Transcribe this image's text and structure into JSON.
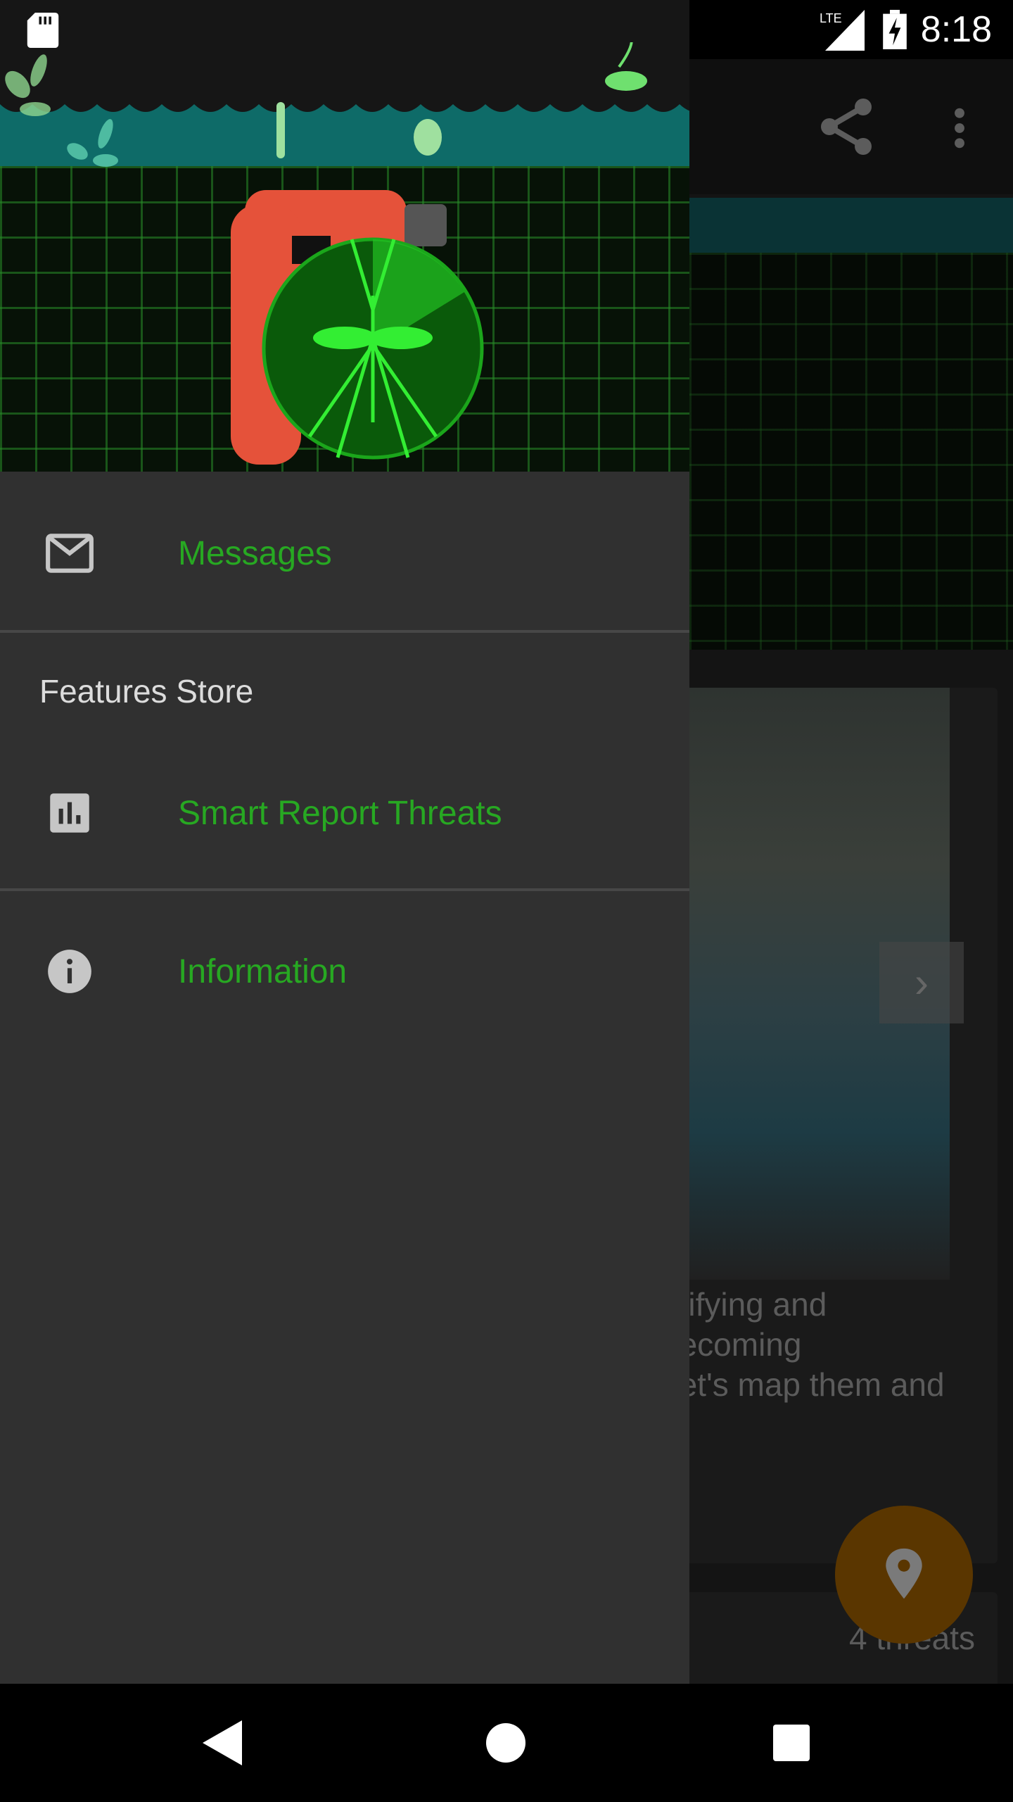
{
  "status_bar": {
    "time": "8:18",
    "network": "LTE",
    "icons": [
      "sd-card-icon",
      "signal-icon",
      "battery-charging-icon"
    ]
  },
  "background": {
    "card_text": [
      "ntifying and",
      "becoming",
      "Let's map them and"
    ],
    "threats_count": "4 threats",
    "fab_icon": "location-pin-icon",
    "toolbar_icons": [
      "share-icon",
      "more-vert-icon"
    ]
  },
  "drawer": {
    "items": [
      {
        "label": "Messages",
        "icon": "mail-icon"
      },
      {
        "label": "Smart Report Threats",
        "icon": "bar-chart-icon"
      },
      {
        "label": "Information",
        "icon": "info-icon"
      }
    ],
    "section_title": "Features Store"
  },
  "colors": {
    "accent": "#27a822",
    "drawer_bg": "#303030",
    "teal": "#0e6b68",
    "fab": "#5a3600"
  },
  "nav_bar": {
    "icons": [
      "back-icon",
      "home-icon",
      "recents-icon"
    ]
  }
}
